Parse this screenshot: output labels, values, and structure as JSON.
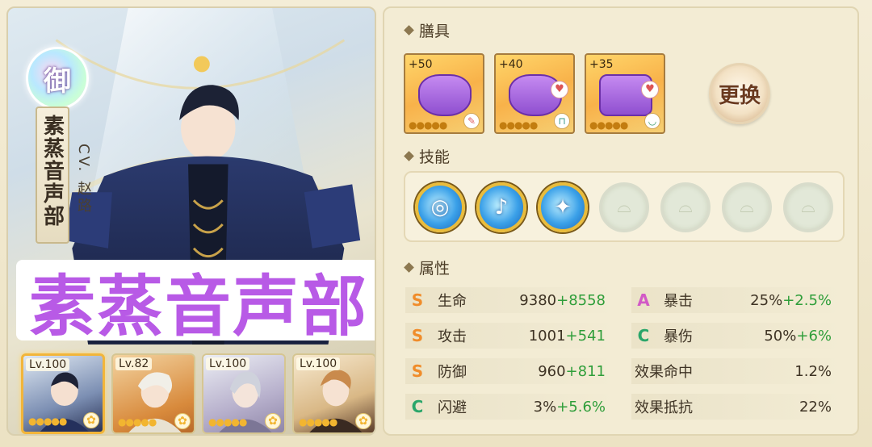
{
  "character": {
    "grade_glyph": "御",
    "name_vertical": "素蒸音声部",
    "cv": "CV. 赵路",
    "overlay_title": "素蒸音声部"
  },
  "team": [
    {
      "level": "Lv.100",
      "stars": "●●●●●",
      "active": true
    },
    {
      "level": "Lv.82",
      "stars": "●●●●●",
      "active": false
    },
    {
      "level": "Lv.100",
      "stars": "●●●●●",
      "active": false
    },
    {
      "level": "Lv.100",
      "stars": "●●●●●",
      "active": false
    }
  ],
  "equipment": {
    "title": "膳具",
    "slots": [
      {
        "bonus": "+50",
        "stars": "●●●●●"
      },
      {
        "bonus": "+40",
        "stars": "●●●●●"
      },
      {
        "bonus": "+35",
        "stars": "●●●●●"
      }
    ],
    "change_label": "更换"
  },
  "skills": {
    "title": "技能",
    "unlocked": 3,
    "total": 7
  },
  "attributes": {
    "title": "属性",
    "rows": [
      {
        "grade": "S",
        "label": "生命",
        "base": "9380",
        "bonus": "+8558"
      },
      {
        "grade": "A",
        "label": "暴击",
        "base": "25%",
        "bonus": "+2.5%"
      },
      {
        "grade": "S",
        "label": "攻击",
        "base": "1001",
        "bonus": "+541"
      },
      {
        "grade": "C",
        "label": "暴伤",
        "base": "50%",
        "bonus": "+6%"
      },
      {
        "grade": "S",
        "label": "防御",
        "base": "960",
        "bonus": "+811"
      },
      {
        "grade": "",
        "label": "效果命中",
        "base": "1.2%",
        "bonus": ""
      },
      {
        "grade": "C",
        "label": "闪避",
        "base": "3%",
        "bonus": "+5.6%"
      },
      {
        "grade": "",
        "label": "效果抵抗",
        "base": "22%",
        "bonus": ""
      }
    ]
  },
  "colors": {
    "grade_S": "#f08c2a",
    "grade_A": "#d25ac6",
    "grade_C": "#2aa66a",
    "bonus_green": "#2f9e3a",
    "overlay_purple": "#b85ae6"
  }
}
